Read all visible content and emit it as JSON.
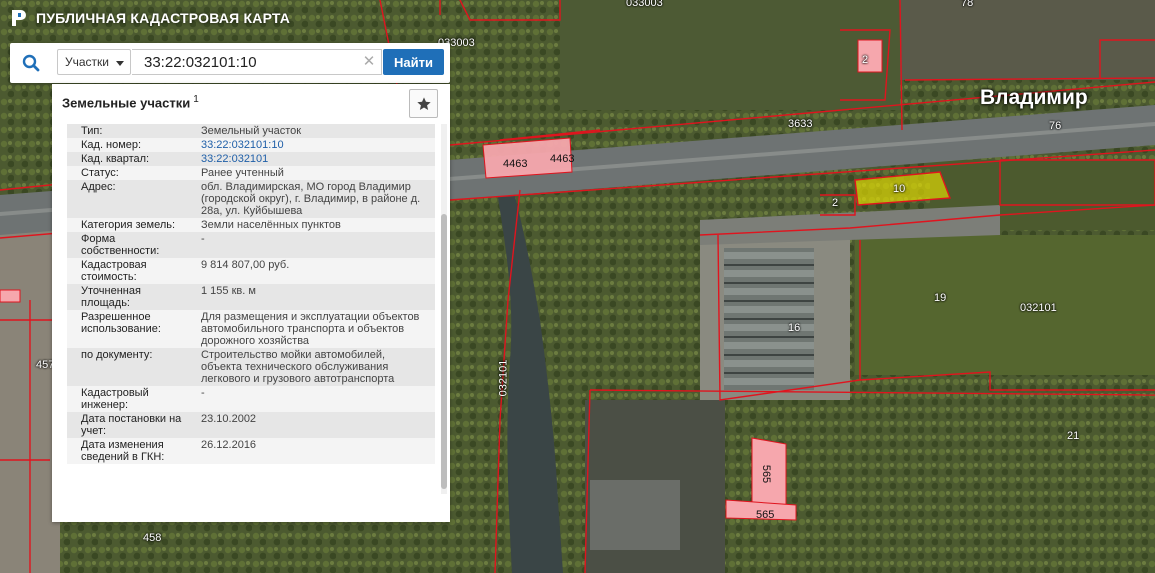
{
  "app": {
    "title": "ПУБЛИЧНАЯ КАДАСТРОВАЯ КАРТА",
    "logo_icon": "cadastre-logo-icon"
  },
  "search": {
    "type_label": "Участки",
    "query": "33:22:032101:10",
    "button_label": "Найти",
    "clear_symbol": "✕"
  },
  "panel": {
    "title": "Земельные участки",
    "count": "1",
    "rows": [
      {
        "label": "Тип:",
        "value": "Земельный участок"
      },
      {
        "label": "Кад. номер:",
        "value": "33:22:032101:10",
        "link": true
      },
      {
        "label": "Кад. квартал:",
        "value": "33:22:032101",
        "link": true
      },
      {
        "label": "Статус:",
        "value": "Ранее учтенный"
      },
      {
        "label": "Адрес:",
        "value": "обл. Владимирская, МО город Владимир (городской округ), г. Владимир, в районе д. 28а, ул. Куйбышева"
      },
      {
        "label": "Категория земель:",
        "value": "Земли населённых пунктов"
      },
      {
        "label": "Форма собственности:",
        "value": "-"
      },
      {
        "label": "Кадастровая стоимость:",
        "value": "9 814 807,00 руб."
      },
      {
        "label": "Уточненная площадь:",
        "value": "1 155 кв. м"
      },
      {
        "label": "Разрешенное использование:",
        "value": "Для размещения и эксплуатации объектов автомобильного транспорта и объектов дорожного хозяйства"
      },
      {
        "label": "по документу:",
        "value": "Строительство мойки автомобилей, объекта технического обслуживания легкового и грузового автотранспорта"
      },
      {
        "label": "Кадастровый инженер:",
        "value": "-"
      },
      {
        "label": "Дата постановки на учет:",
        "value": "23.10.2002"
      },
      {
        "label": "Дата изменения сведений в ГКН:",
        "value": "26.12.2016"
      }
    ]
  },
  "map": {
    "city": "Владимир",
    "highlight_color": "#e8e000",
    "boundary_color": "#e0141e",
    "labels": [
      "033003",
      "033003",
      "78",
      "2",
      "3633",
      "76",
      "4463",
      "4463",
      "10",
      "2",
      "19",
      "032101",
      "16",
      "032101",
      "21",
      "565",
      "565",
      "457",
      "458"
    ]
  }
}
